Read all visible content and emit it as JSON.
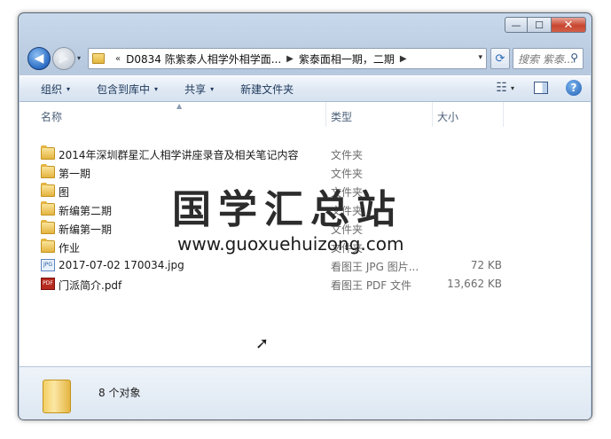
{
  "window": {
    "caption": {
      "minimize": "—",
      "maximize": "☐",
      "close": "✕"
    }
  },
  "nav": {
    "back_glyph": "◀",
    "forward_glyph": "▶",
    "history_glyph": "▾",
    "address": {
      "overflow": "«",
      "crumbs": [
        "D0834 陈紫泰人相学外相学面...",
        "紫泰面相一期，二期"
      ],
      "separator": "▶",
      "dropdown": "▾"
    },
    "refresh_glyph": "⟳",
    "search": {
      "placeholder": "搜索 紫泰...",
      "icon": "⚲"
    }
  },
  "toolbar": {
    "organize": "组织",
    "include_in_library": "包含到库中",
    "share": "共享",
    "new_folder": "新建文件夹",
    "arrow": "▾",
    "view_icon": "☷",
    "help": "?"
  },
  "columns": {
    "name": "名称",
    "type": "类型",
    "size": "大小",
    "sort_arrow": "▲"
  },
  "files": [
    {
      "name": "2014年深圳群星汇人相学讲座录音及相关笔记内容",
      "type": "文件夹",
      "size": "",
      "kind": "folder"
    },
    {
      "name": "第一期",
      "type": "文件夹",
      "size": "",
      "kind": "folder"
    },
    {
      "name": "图",
      "type": "文件夹",
      "size": "",
      "kind": "folder"
    },
    {
      "name": "新编第二期",
      "type": "文件夹",
      "size": "",
      "kind": "folder"
    },
    {
      "name": "新编第一期",
      "type": "文件夹",
      "size": "",
      "kind": "folder"
    },
    {
      "name": "作业",
      "type": "文件夹",
      "size": "",
      "kind": "folder"
    },
    {
      "name": "2017-07-02 170034.jpg",
      "type": "看图王 JPG 图片...",
      "size": "72 KB",
      "kind": "jpg"
    },
    {
      "name": "门派简介.pdf",
      "type": "看图王 PDF 文件",
      "size": "13,662 KB",
      "kind": "pdf"
    }
  ],
  "file_icon_labels": {
    "jpg": "JPG",
    "pdf": "PDF"
  },
  "watermark": {
    "title": "国学汇总站",
    "url": "www.guoxuehuizong.com"
  },
  "details": {
    "count": "8 个对象"
  },
  "cursor_glyph": "➚"
}
